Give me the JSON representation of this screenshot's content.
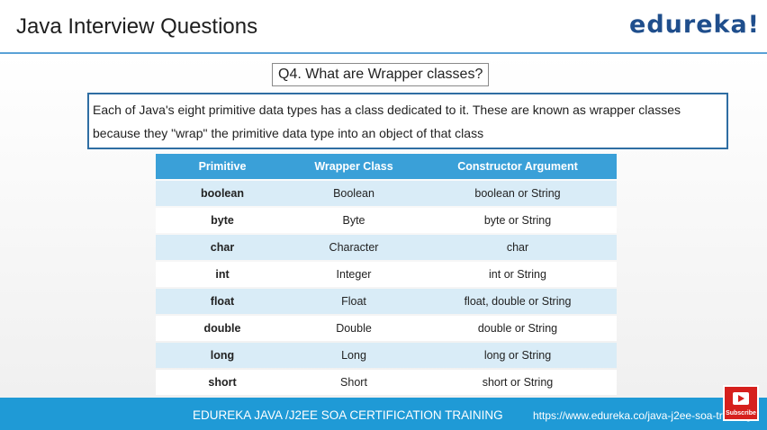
{
  "header": {
    "title": "Java Interview Questions",
    "logo": "edureka!"
  },
  "question": "Q4. What are Wrapper classes?",
  "definition": {
    "line1": "Each of Java's eight primitive data types has a class dedicated to it. These are known as wrapper classes",
    "line2": "because they \"wrap\" the primitive data type into an object of that class"
  },
  "table": {
    "columns": [
      "Primitive",
      "Wrapper Class",
      "Constructor Argument"
    ],
    "rows": [
      [
        "boolean",
        "Boolean",
        "boolean or String"
      ],
      [
        "byte",
        "Byte",
        "byte or String"
      ],
      [
        "char",
        "Character",
        "char"
      ],
      [
        "int",
        "Integer",
        "int or String"
      ],
      [
        "float",
        "Float",
        "float, double or String"
      ],
      [
        "double",
        "Double",
        "double or String"
      ],
      [
        "long",
        "Long",
        "long or String"
      ],
      [
        "short",
        "Short",
        "short or String"
      ]
    ]
  },
  "footer": {
    "title": "EDUREKA JAVA /J2EE SOA CERTIFICATION TRAINING",
    "url": "https://www.edureka.co/java-j2ee-soa-training"
  },
  "subscribe": {
    "icon": "play-icon",
    "label": "Subscribe"
  },
  "colors": {
    "accent": "#3aa0d8",
    "footer": "#1f9ad6",
    "logo": "#1f4e8c"
  }
}
